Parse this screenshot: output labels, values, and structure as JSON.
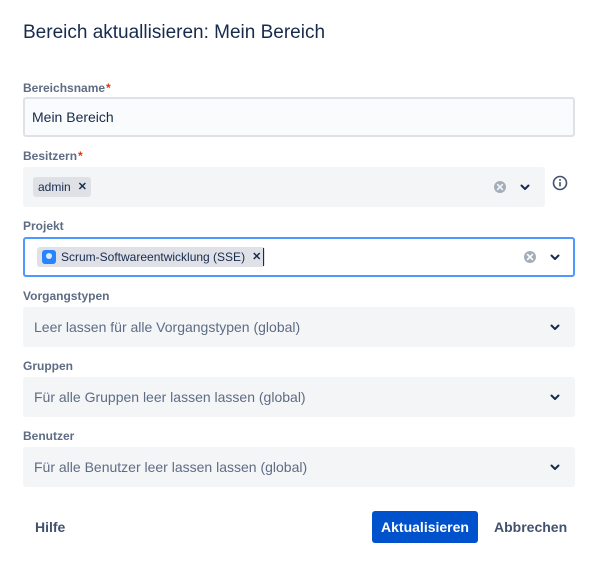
{
  "dialog": {
    "title": "Bereich aktuallisieren: Mein Bereich"
  },
  "fields": {
    "name": {
      "label": "Bereichsname",
      "required": "*",
      "value": "Mein Bereich"
    },
    "owner": {
      "label": "Besitzern",
      "required": "*",
      "chip": "admin"
    },
    "project": {
      "label": "Projekt",
      "chip": "Scrum-Softwareentwicklung (SSE)"
    },
    "issue_types": {
      "label": "Vorgangstypen",
      "placeholder": "Leer lassen für alle Vorgangstypen (global)"
    },
    "groups": {
      "label": "Gruppen",
      "placeholder": "Für alle Gruppen leer lassen lassen (global)"
    },
    "users": {
      "label": "Benutzer",
      "placeholder": "Für alle Benutzer leer lassen lassen (global)"
    }
  },
  "footer": {
    "help": "Hilfe",
    "submit": "Aktualisieren",
    "cancel": "Abbrechen"
  },
  "icons": {
    "chip_remove": "close-icon",
    "clear": "clear-icon",
    "caret": "chevron-down-icon",
    "info": "info-icon",
    "project_avatar": "project-avatar-icon"
  },
  "colors": {
    "primary": "#0052CC",
    "focus_border": "#4C9AFF",
    "required": "#DE350B",
    "field_bg": "#F4F5F7"
  }
}
